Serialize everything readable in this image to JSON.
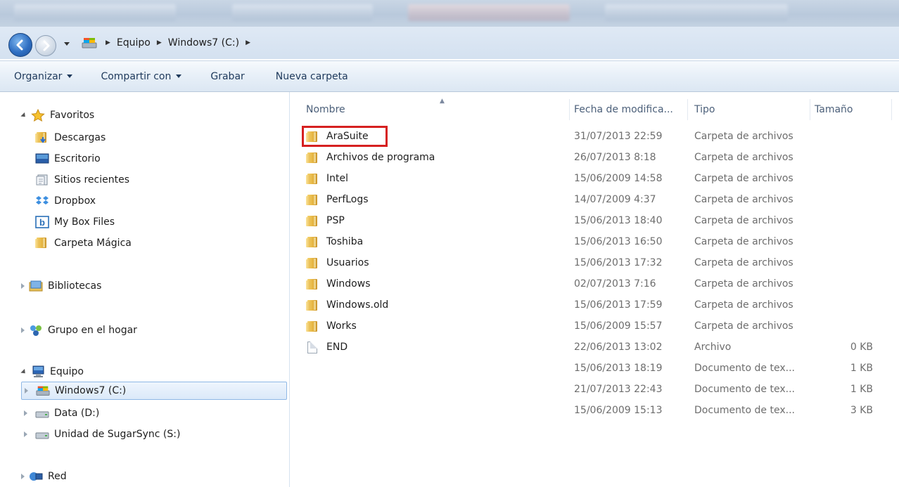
{
  "address": {
    "crumbs": [
      "Equipo",
      "Windows7 (C:)"
    ]
  },
  "toolbar": {
    "organize_label": "Organizar",
    "share_label": "Compartir con",
    "burn_label": "Grabar",
    "new_folder_label": "Nueva carpeta"
  },
  "nav": {
    "favorites": {
      "label": "Favoritos",
      "items": [
        {
          "label": "Descargas",
          "icon": "downloads-icon"
        },
        {
          "label": "Escritorio",
          "icon": "desktop-icon"
        },
        {
          "label": "Sitios recientes",
          "icon": "recent-places-icon"
        },
        {
          "label": "Dropbox",
          "icon": "dropbox-icon"
        },
        {
          "label": "My Box Files",
          "icon": "box-icon"
        },
        {
          "label": "Carpeta Mágica",
          "icon": "folder-icon"
        }
      ]
    },
    "libraries": {
      "label": "Bibliotecas"
    },
    "homegroup": {
      "label": "Grupo en el hogar"
    },
    "computer": {
      "label": "Equipo",
      "items": [
        {
          "label": "Windows7 (C:)",
          "icon": "system-drive-icon",
          "selected": true
        },
        {
          "label": "Data (D:)",
          "icon": "drive-icon"
        },
        {
          "label": "Unidad de SugarSync (S:)",
          "icon": "drive-icon"
        }
      ]
    },
    "network": {
      "label": "Red"
    }
  },
  "files": {
    "columns": [
      "Nombre",
      "Fecha de modifica...",
      "Tipo",
      "Tamaño"
    ],
    "rows": [
      {
        "name": "AraSuite",
        "date": "31/07/2013 22:59",
        "type": "Carpeta de archivos",
        "size": "",
        "icon": "folder-icon"
      },
      {
        "name": "Archivos de programa",
        "date": "26/07/2013 8:18",
        "type": "Carpeta de archivos",
        "size": "",
        "icon": "folder-icon"
      },
      {
        "name": "Intel",
        "date": "15/06/2009 14:58",
        "type": "Carpeta de archivos",
        "size": "",
        "icon": "folder-icon"
      },
      {
        "name": "PerfLogs",
        "date": "14/07/2009 4:37",
        "type": "Carpeta de archivos",
        "size": "",
        "icon": "folder-icon"
      },
      {
        "name": "PSP",
        "date": "15/06/2013 18:40",
        "type": "Carpeta de archivos",
        "size": "",
        "icon": "folder-icon"
      },
      {
        "name": "Toshiba",
        "date": "15/06/2013 16:50",
        "type": "Carpeta de archivos",
        "size": "",
        "icon": "folder-icon"
      },
      {
        "name": "Usuarios",
        "date": "15/06/2013 17:32",
        "type": "Carpeta de archivos",
        "size": "",
        "icon": "folder-icon"
      },
      {
        "name": "Windows",
        "date": "02/07/2013 7:16",
        "type": "Carpeta de archivos",
        "size": "",
        "icon": "folder-icon"
      },
      {
        "name": "Windows.old",
        "date": "15/06/2013 17:59",
        "type": "Carpeta de archivos",
        "size": "",
        "icon": "folder-icon"
      },
      {
        "name": "Works",
        "date": "15/06/2009 15:57",
        "type": "Carpeta de archivos",
        "size": "",
        "icon": "folder-icon"
      },
      {
        "name": "END",
        "date": "22/06/2013 13:02",
        "type": "Archivo",
        "size": "0 KB",
        "icon": "file-icon"
      },
      {
        "name": "",
        "date": "15/06/2013 18:19",
        "type": "Documento de tex...",
        "size": "1 KB",
        "icon": ""
      },
      {
        "name": "",
        "date": "21/07/2013 22:43",
        "type": "Documento de tex...",
        "size": "1 KB",
        "icon": ""
      },
      {
        "name": "",
        "date": "15/06/2009 15:13",
        "type": "Documento de tex...",
        "size": "3 KB",
        "icon": ""
      }
    ]
  },
  "colors": {
    "highlight": "#d62020",
    "selection": "#dbe9f9",
    "toolbar_text": "#1e395b"
  }
}
